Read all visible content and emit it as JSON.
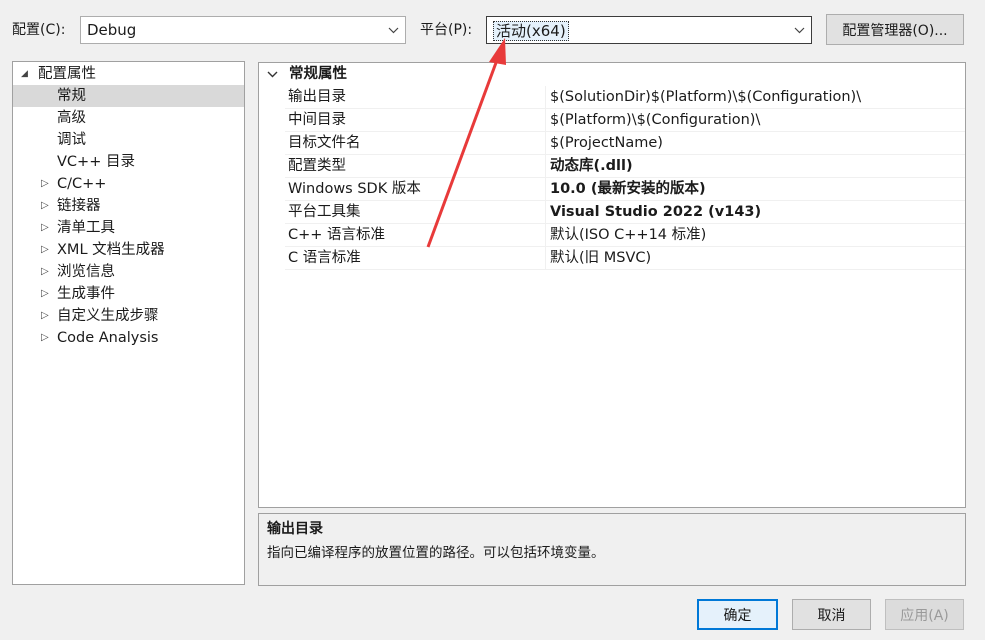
{
  "toolbar": {
    "config_label": "配置(C):",
    "config_value": "Debug",
    "platform_label": "平台(P):",
    "platform_value": "活动(x64)",
    "manager_button": "配置管理器(O)..."
  },
  "tree": {
    "root": "配置属性",
    "items": [
      {
        "label": "常规",
        "expandable": false,
        "selected": true
      },
      {
        "label": "高级",
        "expandable": false
      },
      {
        "label": "调试",
        "expandable": false
      },
      {
        "label": "VC++ 目录",
        "expandable": false
      },
      {
        "label": "C/C++",
        "expandable": true
      },
      {
        "label": "链接器",
        "expandable": true
      },
      {
        "label": "清单工具",
        "expandable": true
      },
      {
        "label": "XML 文档生成器",
        "expandable": true
      },
      {
        "label": "浏览信息",
        "expandable": true
      },
      {
        "label": "生成事件",
        "expandable": true
      },
      {
        "label": "自定义生成步骤",
        "expandable": true
      },
      {
        "label": "Code Analysis",
        "expandable": true
      }
    ]
  },
  "grid": {
    "category": "常规属性",
    "rows": [
      {
        "key": "输出目录",
        "value": "$(SolutionDir)$(Platform)\\$(Configuration)\\",
        "bold": false
      },
      {
        "key": "中间目录",
        "value": "$(Platform)\\$(Configuration)\\",
        "bold": false
      },
      {
        "key": "目标文件名",
        "value": "$(ProjectName)",
        "bold": false
      },
      {
        "key": "配置类型",
        "value": "动态库(.dll)",
        "bold": true
      },
      {
        "key": "Windows SDK 版本",
        "value": "10.0 (最新安装的版本)",
        "bold": true
      },
      {
        "key": "平台工具集",
        "value": "Visual Studio 2022 (v143)",
        "bold": true
      },
      {
        "key": "C++ 语言标准",
        "value": "默认(ISO C++14 标准)",
        "bold": false
      },
      {
        "key": "C 语言标准",
        "value": "默认(旧 MSVC)",
        "bold": false
      }
    ]
  },
  "description": {
    "title": "输出目录",
    "text": "指向已编译程序的放置位置的路径。可以包括环境变量。"
  },
  "buttons": {
    "ok": "确定",
    "cancel": "取消",
    "apply": "应用(A)"
  },
  "annotation": {
    "arrow_color": "#e83a3a"
  }
}
